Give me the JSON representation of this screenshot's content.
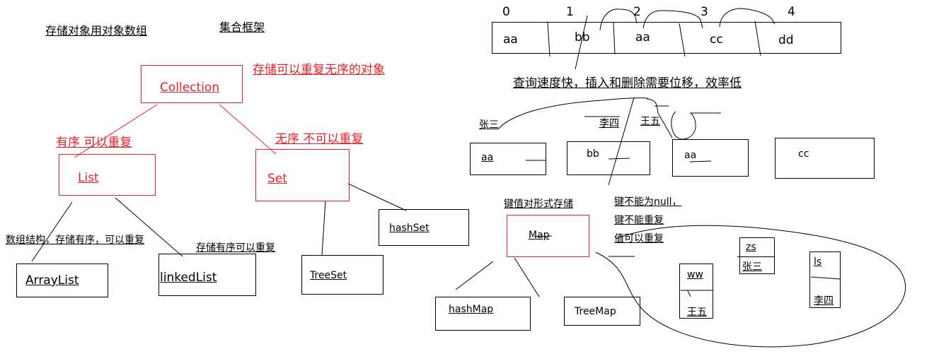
{
  "colors": {
    "red": "#e8202a",
    "black": "#000000"
  },
  "left": {
    "note_array": "存储对象用对象数组",
    "title": "集合框架",
    "collection": {
      "label": "Collection",
      "note": "存储可以重复无序的对象"
    },
    "list": {
      "label": "List",
      "note": "有序 可以重复"
    },
    "set": {
      "label": "Set",
      "note": "无序 不可以重复"
    },
    "arraylist": {
      "label": "ArrayList",
      "note": "数组结构，存储有序，可以重复"
    },
    "linkedlist": {
      "label": "linkedList",
      "note": "存储有序可以重复"
    },
    "treeset": {
      "label": "TreeSet"
    },
    "hashset": {
      "label": "hashSet"
    }
  },
  "array": {
    "indices": [
      "0",
      "1",
      "2",
      "3",
      "4"
    ],
    "cells": [
      "aa",
      "bb",
      "aa",
      "cc",
      "dd"
    ],
    "note": "查询速度快，插入和删除需要位移，效率低"
  },
  "linked": {
    "names": [
      "张三",
      "李四",
      "王五"
    ],
    "nodes": [
      "aa",
      "bb",
      "aa",
      "cc"
    ]
  },
  "map": {
    "label": "Map",
    "note": "键值对形式存储",
    "rules": [
      "键不能为null，",
      "键不能重复",
      "值可以重复"
    ],
    "hashmap": "hashMap",
    "treemap": "TreeMap",
    "entries": [
      {
        "key": "zs",
        "value": "张三"
      },
      {
        "key": "ww",
        "value": "王五"
      },
      {
        "key": "ls",
        "value": "李四"
      }
    ]
  }
}
